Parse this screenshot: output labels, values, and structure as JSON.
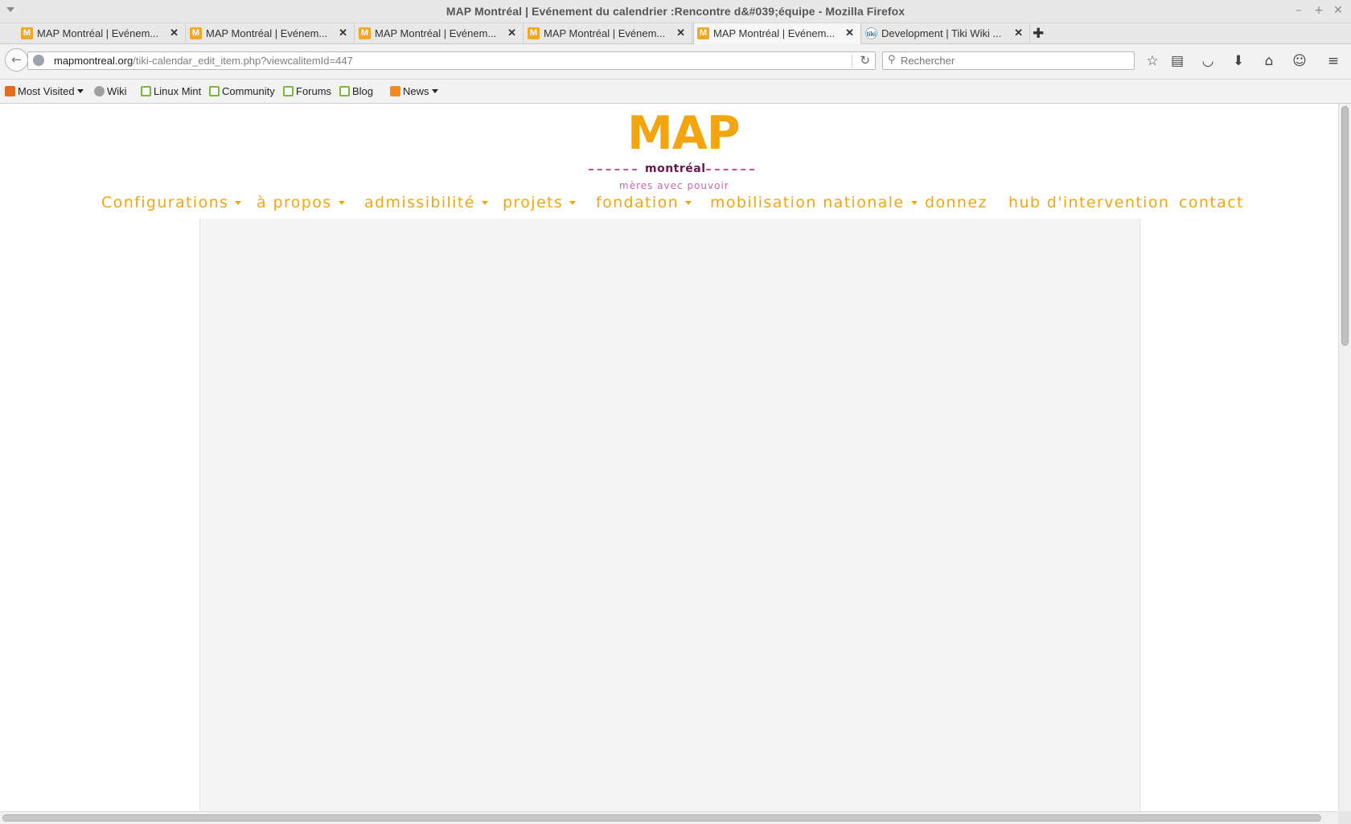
{
  "window": {
    "title": "MAP Montréal | Evénement du calendrier :Rencontre d&#039;équipe - Mozilla Firefox"
  },
  "tabs": [
    {
      "label": "MAP Montréal | Evénem...",
      "favicon": "M",
      "active": false
    },
    {
      "label": "MAP Montréal | Evénem...",
      "favicon": "M",
      "active": false
    },
    {
      "label": "MAP Montréal | Evénem...",
      "favicon": "M",
      "active": false
    },
    {
      "label": "MAP Montréal | Evénem...",
      "favicon": "M",
      "active": false
    },
    {
      "label": "MAP Montréal | Evénem...",
      "favicon": "M",
      "active": true
    },
    {
      "label": "Development | Tiki Wiki ...",
      "favicon": "tiki",
      "active": false
    }
  ],
  "navbar": {
    "url_host": "mapmontreal.org",
    "url_path": "/tiki-calendar_edit_item.php?viewcalitemId=447",
    "search_placeholder": "Rechercher"
  },
  "bookmarks": [
    {
      "label": "Most Visited",
      "icon": "most-visited-icon",
      "dropdown": true
    },
    {
      "label": "Wiki",
      "icon": "globe-icon",
      "dropdown": false
    },
    {
      "label": "Linux Mint",
      "icon": "mint-icon",
      "dropdown": false
    },
    {
      "label": "Community",
      "icon": "mint-icon",
      "dropdown": false
    },
    {
      "label": "Forums",
      "icon": "mint-icon",
      "dropdown": false
    },
    {
      "label": "Blog",
      "icon": "mint-icon",
      "dropdown": false
    },
    {
      "label": "News",
      "icon": "rss-icon",
      "dropdown": true
    }
  ],
  "logo": {
    "main": "MAP",
    "sub": "montréal",
    "tagline": "mères avec pouvoir"
  },
  "site_nav": [
    {
      "label": "Configurations",
      "dropdown": true
    },
    {
      "label": "à propos",
      "dropdown": true
    },
    {
      "label": "admissibilité",
      "dropdown": true
    },
    {
      "label": "projets",
      "dropdown": true
    },
    {
      "label": "fondation",
      "dropdown": true
    },
    {
      "label": "mobilisation nationale",
      "dropdown": true
    },
    {
      "label": "donnez",
      "dropdown": false
    },
    {
      "label": "hub d'intervention",
      "dropdown": false
    },
    {
      "label": "contact",
      "dropdown": false
    }
  ],
  "colors": {
    "brand_orange": "#f2a50f",
    "brand_purple": "#6b1650",
    "brand_pink": "#c06aa8",
    "content_bg": "#f4f4f4"
  }
}
